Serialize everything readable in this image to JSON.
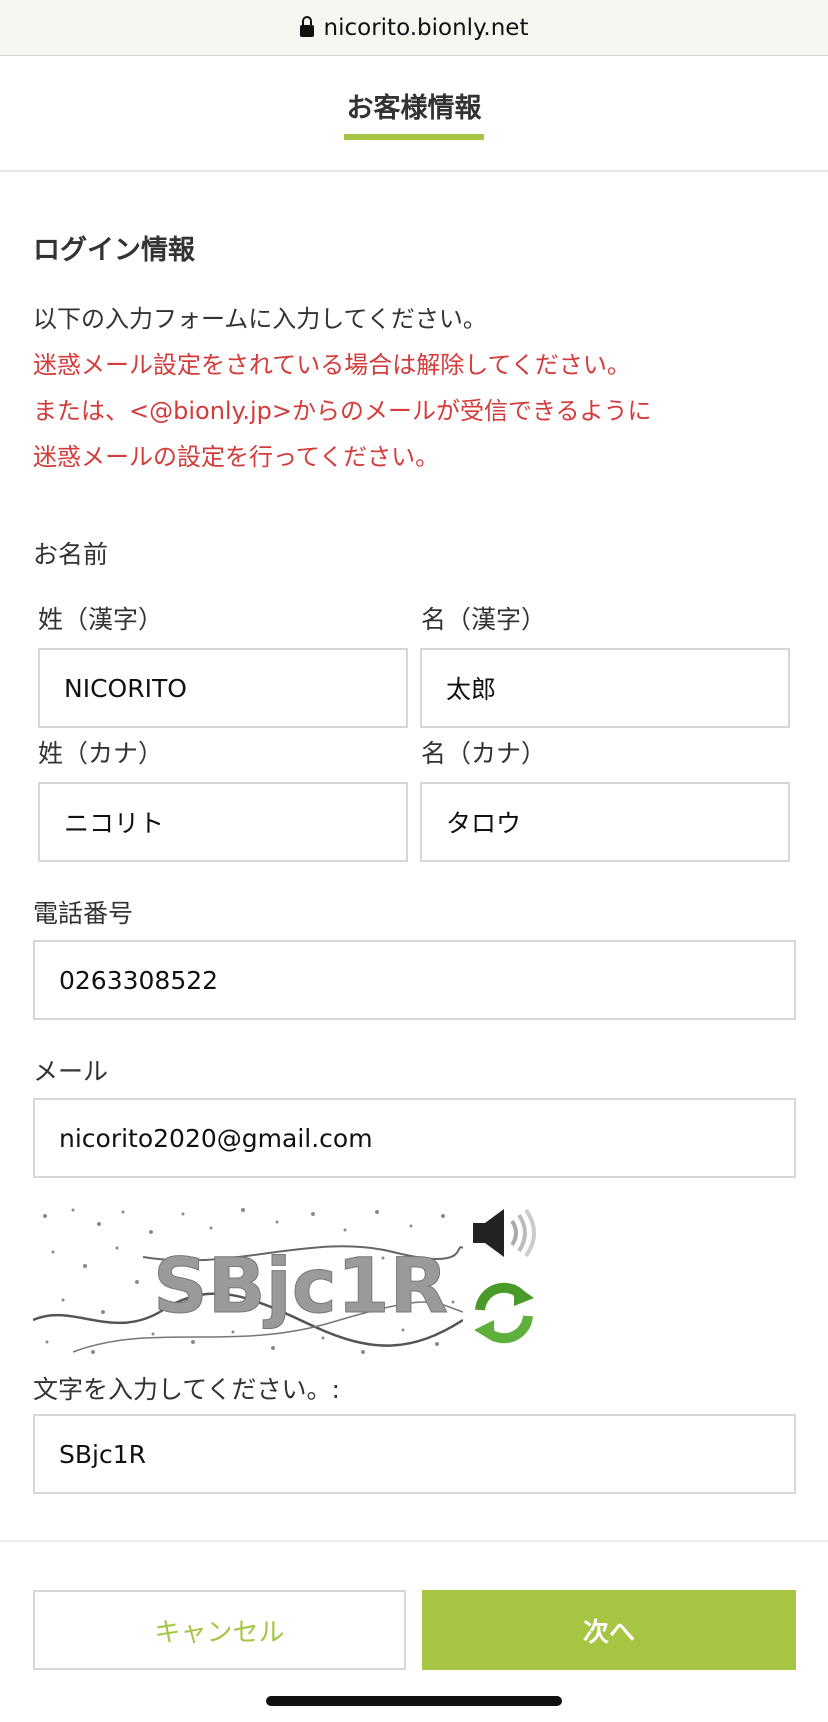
{
  "browser": {
    "url": "nicorito.bionly.net"
  },
  "header": {
    "tab_label": "お客様情報",
    "accent": "#a5c543"
  },
  "section": {
    "title": "ログイン情報",
    "instruction": "以下の入力フォームに入力してください。",
    "warning_lines": [
      "迷惑メール設定をされている場合は解除してください。",
      "または、<@bionly.jp>からのメールが受信できるように",
      "迷惑メールの設定を行ってください。"
    ],
    "warning_color": "#d43c3c"
  },
  "form": {
    "name_label": "お名前",
    "last_kanji_label": "姓（漢字）",
    "first_kanji_label": "名（漢字）",
    "last_kanji_value": "NICORITO",
    "first_kanji_value": "太郎",
    "last_kana_label": "姓（カナ）",
    "first_kana_label": "名（カナ）",
    "last_kana_value": "ニコリト",
    "first_kana_value": "タロウ",
    "phone_label": "電話番号",
    "phone_value": "0263308522",
    "email_label": "メール",
    "email_value": "nicorito2020@gmail.com",
    "captcha_text": "SBjc1R",
    "captcha_input_label": "文字を入力してください。:",
    "captcha_input_value": "SBjc1R"
  },
  "icons": {
    "audio": "speaker-icon",
    "refresh": "refresh-icon",
    "lock": "lock-icon"
  },
  "buttons": {
    "cancel": "キャンセル",
    "next": "次へ"
  }
}
